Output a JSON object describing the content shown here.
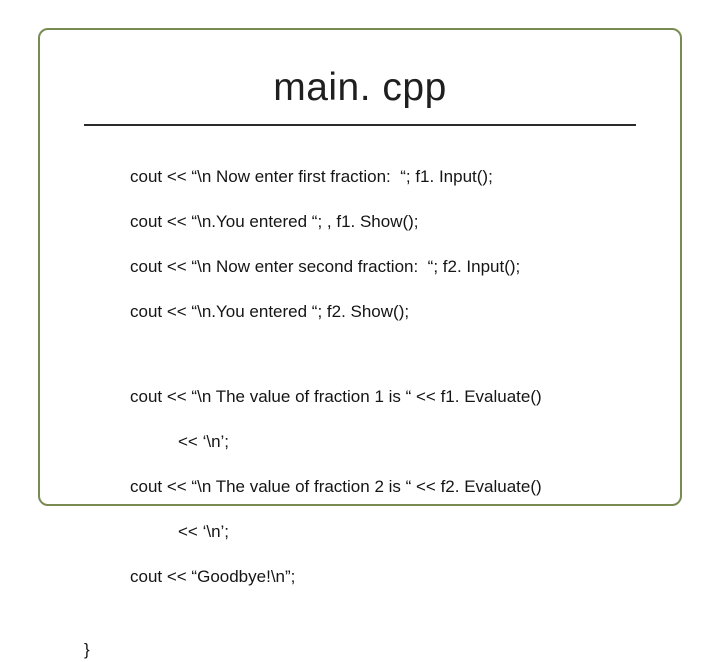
{
  "slide": {
    "title": "main. cpp",
    "code": {
      "l1": "cout << “\\n Now enter first fraction:  “; f1. Input();",
      "l2": "cout << “\\n.You entered “; , f1. Show();",
      "l3": "cout << “\\n Now enter second fraction:  “; f2. Input();",
      "l4": "cout << “\\n.You entered “; f2. Show();",
      "l5": "cout << “\\n The value of fraction 1 is “ << f1. Evaluate()",
      "l5b": "<< ‘\\n’;",
      "l6": "cout << “\\n The value of fraction 2 is “ << f2. Evaluate()",
      "l6b": "<< ‘\\n’;",
      "l7": "cout << “Goodbye!\\n”;",
      "brace": "}"
    }
  }
}
